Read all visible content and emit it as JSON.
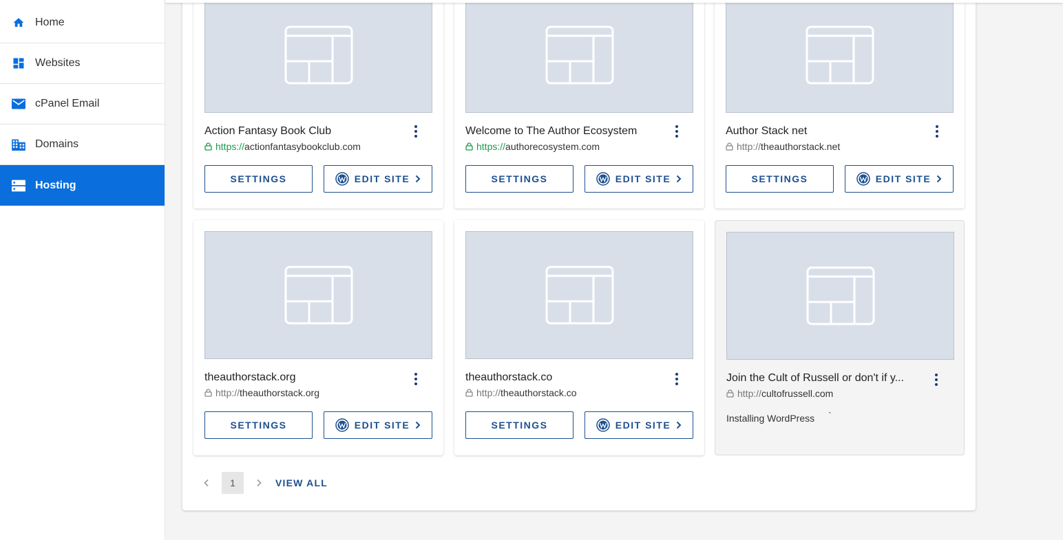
{
  "sidebar": {
    "items": [
      {
        "label": "Home",
        "icon": "home-icon"
      },
      {
        "label": "Websites",
        "icon": "dashboard-icon"
      },
      {
        "label": "cPanel Email",
        "icon": "envelope-icon"
      },
      {
        "label": "Domains",
        "icon": "building-icon"
      },
      {
        "label": "Hosting",
        "icon": "server-icon",
        "active": true
      }
    ]
  },
  "colors": {
    "accent": "#0a6edc",
    "button": "#1d4f8f",
    "secure": "#1a9b4b",
    "thumbnail": "#d8dfe9"
  },
  "sites": [
    {
      "title": "Action Fantasy Book Club",
      "protocol": "https://",
      "host": "actionfantasybookclub.com",
      "secure": true
    },
    {
      "title": "Welcome to The Author Ecosystem",
      "protocol": "https://",
      "host": "authorecosystem.com",
      "secure": true
    },
    {
      "title": "Author Stack net",
      "protocol": "http://",
      "host": "theauthorstack.net",
      "secure": false
    },
    {
      "title": "theauthorstack.org",
      "protocol": "http://",
      "host": "theauthorstack.org",
      "secure": false
    },
    {
      "title": "theauthorstack.co",
      "protocol": "http://",
      "host": "theauthorstack.co",
      "secure": false
    },
    {
      "title": "Join the Cult of Russell or don't if y...",
      "protocol": "http://",
      "host": "cultofrussell.com",
      "secure": false,
      "status": "Installing WordPress"
    }
  ],
  "buttons": {
    "settings": "SETTINGS",
    "edit_site": "EDIT SITE"
  },
  "pagination": {
    "current_page": "1",
    "view_all": "VIEW ALL"
  }
}
